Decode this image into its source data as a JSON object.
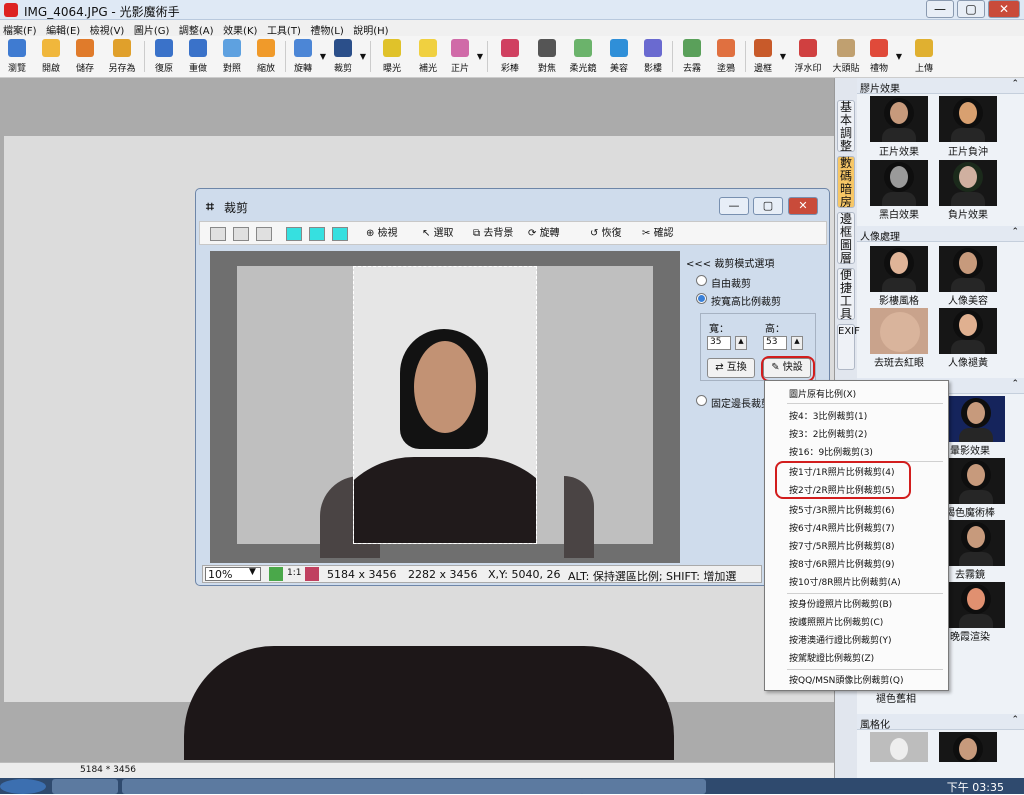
{
  "window": {
    "title": "IMG_4064.JPG - 光影魔術手",
    "buttons": [
      "—",
      "▢",
      "✕"
    ]
  },
  "menu": [
    "檔案(F)",
    "編輯(E)",
    "檢視(V)",
    "圖片(G)",
    "調整(A)",
    "效果(K)",
    "工具(T)",
    "禮物(L)",
    "說明(H)"
  ],
  "toolbar": [
    {
      "label": "瀏覽",
      "icon": "eye-icon",
      "color": "#3f7bd1"
    },
    {
      "label": "開啟",
      "icon": "folder-open-icon",
      "color": "#f0b73c"
    },
    {
      "label": "儲存",
      "icon": "save-icon",
      "color": "#e07b2b"
    },
    {
      "label": "另存為",
      "icon": "save-as-icon",
      "color": "#e0a02b"
    },
    {
      "label": "復原",
      "icon": "undo-icon",
      "color": "#3a72c9"
    },
    {
      "label": "重做",
      "icon": "redo-icon",
      "color": "#3a72c9"
    },
    {
      "label": "對照",
      "icon": "compare-icon",
      "color": "#5ea1e0"
    },
    {
      "label": "縮放",
      "icon": "resize-icon",
      "color": "#f09a2a"
    },
    {
      "label": "旋轉",
      "icon": "rotate-icon",
      "color": "#4c86d6",
      "dd": true
    },
    {
      "label": "裁剪",
      "icon": "crop-icon",
      "color": "#2b4f8a",
      "dd": true
    },
    {
      "label": "曝光",
      "icon": "sun-icon",
      "color": "#e0c22a"
    },
    {
      "label": "補光",
      "icon": "bulb-icon",
      "color": "#f0d040"
    },
    {
      "label": "正片",
      "icon": "film-icon",
      "color": "#d06aa8",
      "dd": true
    },
    {
      "label": "彩棒",
      "icon": "color-wand-icon",
      "color": "#d04060"
    },
    {
      "label": "對焦",
      "icon": "focus-icon",
      "color": "#555555"
    },
    {
      "label": "柔光鏡",
      "icon": "soft-light-icon",
      "color": "#6bb36b"
    },
    {
      "label": "美容",
      "icon": "beauty-icon",
      "color": "#2f8fd8"
    },
    {
      "label": "影樓",
      "icon": "studio-icon",
      "color": "#6a6ad0"
    },
    {
      "label": "去霧",
      "icon": "defog-icon",
      "color": "#5aa05a"
    },
    {
      "label": "塗鴉",
      "icon": "brush-icon",
      "color": "#e07040"
    },
    {
      "label": "邊框",
      "icon": "frame-icon",
      "color": "#c85a2a",
      "dd": true
    },
    {
      "label": "浮水印",
      "icon": "watermark-icon",
      "color": "#d04040"
    },
    {
      "label": "大頭貼",
      "icon": "sticker-icon",
      "color": "#c0a070"
    },
    {
      "label": "禮物",
      "icon": "gift-icon",
      "color": "#e04a3a",
      "dd": true
    },
    {
      "label": "上傳",
      "icon": "upload-icon",
      "color": "#e0b030"
    }
  ],
  "dialog": {
    "title": "裁剪",
    "tools": [
      {
        "label": "檢視",
        "icon": "zoom-icon"
      },
      {
        "label": "選取",
        "icon": "pointer-icon"
      },
      {
        "label": "去背景",
        "icon": "remove-bg-icon"
      },
      {
        "label": "旋轉",
        "icon": "rotate-icon"
      },
      {
        "label": "恢復",
        "icon": "restore-icon"
      },
      {
        "label": "確認",
        "icon": "confirm-icon"
      }
    ],
    "options": {
      "header": "<<< 裁剪模式選項",
      "free": "自由裁剪",
      "ratio": "按寬高比例裁剪",
      "fixed": "固定邊長裁剪",
      "width_label": "寬：",
      "height_label": "高：",
      "width": "35",
      "height": "53",
      "swap": "互換",
      "preset": "快設"
    },
    "status": {
      "zoom": "10%",
      "oneone": "1:1",
      "size": "5184 x 3456",
      "crop": "2282 x 3456",
      "xy": "X,Y: 5040, 26",
      "hint": "ALT: 保持選區比例;  SHIFT: 增加選"
    }
  },
  "context_menu": [
    "圖片原有比例(X)",
    "按4：3比例裁剪(1)",
    "按3：2比例裁剪(2)",
    "按16：9比例裁剪(3)",
    "按1寸/1R照片比例裁剪(4)",
    "按2寸/2R照片比例裁剪(5)",
    "按5寸/3R照片比例裁剪(6)",
    "按6寸/4R照片比例裁剪(7)",
    "按7寸/5R照片比例裁剪(8)",
    "按8寸/6R照片比例裁剪(9)",
    "按10寸/8R照片比例裁剪(A)",
    "按身份證照片比例裁剪(B)",
    "按護照照片比例裁剪(C)",
    "按港澳通行證比例裁剪(Y)",
    "按駕駛證比例裁剪(Z)",
    "按QQ/MSN頭像比例裁剪(Q)"
  ],
  "right_panel": {
    "vtabs": [
      "基本調整",
      "數碼暗房",
      "邊框圖層",
      "便捷工具",
      "EXIF"
    ],
    "sections": [
      {
        "title": "膠片效果",
        "items": [
          "正片效果",
          "正片負沖",
          "黑白效果",
          "負片效果"
        ]
      },
      {
        "title": "人像處理",
        "items": [
          "影樓風格",
          "人像美容",
          "去斑去紅眼",
          "人像褪黃"
        ]
      }
    ],
    "partial_labels": [
      "暈影效果",
      "褐色魔術棒",
      "去霧鏡",
      "晚霞渲染",
      "褪色舊相"
    ],
    "style_section": "風格化"
  },
  "statusbar": {
    "size": "5184 * 3456"
  },
  "taskbar": {
    "clock": "下午 03:35"
  }
}
